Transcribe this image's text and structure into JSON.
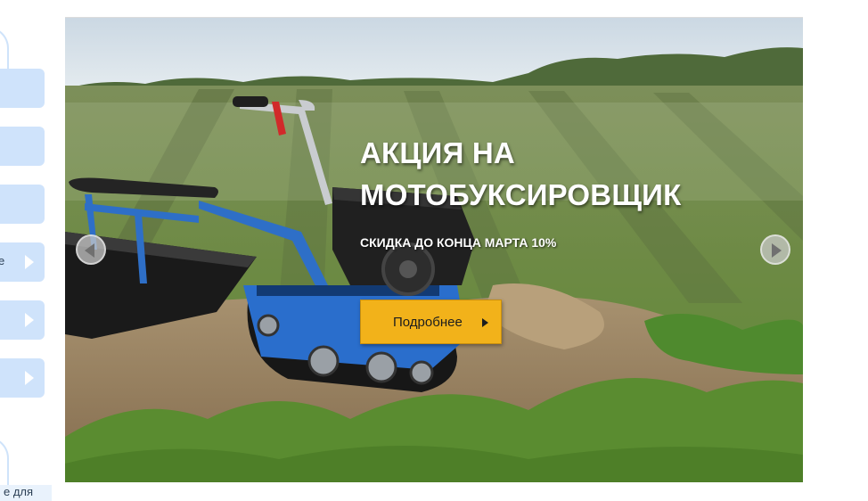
{
  "sidebar": {
    "items": [
      {
        "fragment": ""
      },
      {
        "fragment": ""
      },
      {
        "fragment": ""
      },
      {
        "fragment": "е"
      },
      {
        "fragment": ""
      },
      {
        "fragment": ""
      }
    ],
    "bottom_fragment": "е для"
  },
  "slider": {
    "headline_line1": "АКЦИЯ НА",
    "headline_line2": "МОТОБУКСИРОВЩИК",
    "subtitle": "СКИДКА ДО КОНЦА МАРТА 10%",
    "button_label": "Подробнее",
    "button_icon": "triangle-right-icon",
    "prev_icon": "chevron-left-icon",
    "next_icon": "chevron-right-icon"
  },
  "colors": {
    "sidebar_item": "#cfe3fb",
    "button_bg": "#f2b21a",
    "headline_text": "#ffffff"
  }
}
